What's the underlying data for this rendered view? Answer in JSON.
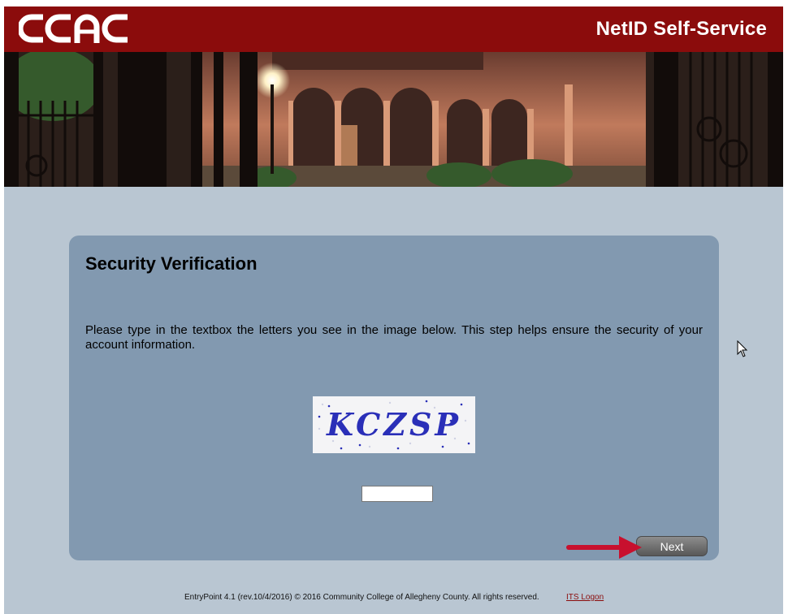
{
  "header": {
    "logo_text": "CCAC",
    "title": "NetID Self-Service",
    "brand_color": "#8b0c0c"
  },
  "panel": {
    "title": "Security Verification",
    "instructions": "Please type in the textbox the letters you see in the image below. This step helps ensure the security of your account information.",
    "captcha_text": "KCZSP",
    "input_value": "",
    "next_label": "Next"
  },
  "footer": {
    "text": "EntryPoint 4.1 (rev.10/4/2016) © 2016 Community College of Allegheny County. All rights reserved.",
    "link_label": "ITS Logon"
  },
  "colors": {
    "page_bg": "#b9c6d2",
    "panel_bg": "#8299b0",
    "annotation_arrow": "#c8102e"
  }
}
